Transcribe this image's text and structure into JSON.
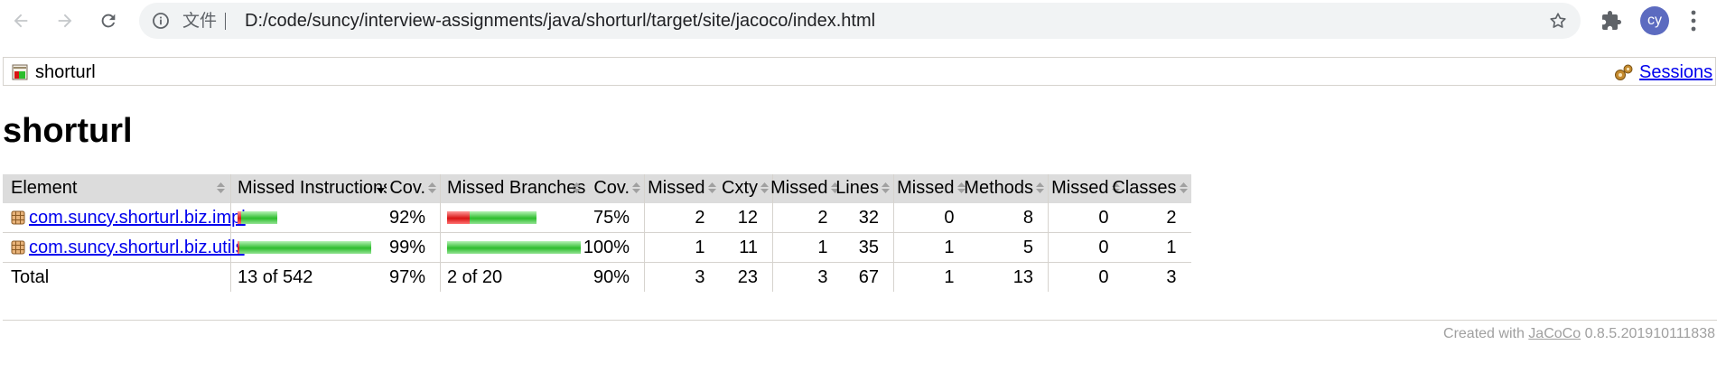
{
  "browser": {
    "back_icon": "back-arrow-icon",
    "forward_icon": "forward-arrow-icon",
    "reload_icon": "reload-icon",
    "site_info_label": "文件",
    "url": "D:/code/suncy/interview-assignments/java/shorturl/target/site/jacoco/index.html",
    "avatar_initials": "cy"
  },
  "breadcrumb": {
    "label": "shorturl",
    "sessions_label": "Sessions"
  },
  "page_title": "shorturl",
  "table": {
    "headers": {
      "element": "Element",
      "missed_instructions": "Missed Instructions",
      "instr_cov": "Cov.",
      "missed_branches": "Missed Branches",
      "branch_cov": "Cov.",
      "missed_cxty": "Missed",
      "cxty": "Cxty",
      "missed_lines": "Missed",
      "lines": "Lines",
      "missed_methods": "Missed",
      "methods": "Methods",
      "missed_classes": "Missed",
      "classes": "Classes"
    },
    "rows": [
      {
        "element": "com.suncy.shorturl.biz.impl",
        "instr_bar": {
          "missed_fraction": 0.08,
          "width_fraction": 0.3
        },
        "instr_cov": "92%",
        "branch_bar": {
          "missed_fraction": 0.25,
          "width_fraction": 0.667
        },
        "branch_cov": "75%",
        "missed_cxty": "2",
        "cxty": "12",
        "missed_lines": "2",
        "lines": "32",
        "missed_methods": "0",
        "methods": "8",
        "missed_classes": "0",
        "classes": "2"
      },
      {
        "element": "com.suncy.shorturl.biz.utils",
        "instr_bar": {
          "missed_fraction": 0.01,
          "width_fraction": 1.0
        },
        "instr_cov": "99%",
        "branch_bar": {
          "missed_fraction": 0.0,
          "width_fraction": 1.0
        },
        "branch_cov": "100%",
        "missed_cxty": "1",
        "cxty": "11",
        "missed_lines": "1",
        "lines": "35",
        "missed_methods": "1",
        "methods": "5",
        "missed_classes": "0",
        "classes": "1"
      }
    ],
    "total": {
      "label": "Total",
      "missed_instructions": "13 of 542",
      "instr_cov": "97%",
      "missed_branches": "2 of 20",
      "branch_cov": "90%",
      "missed_cxty": "3",
      "cxty": "23",
      "missed_lines": "3",
      "lines": "67",
      "missed_methods": "1",
      "methods": "13",
      "missed_classes": "0",
      "classes": "3"
    }
  },
  "footer": {
    "prefix": "Created with",
    "link": "JaCoCo",
    "version": "0.8.5.201910111838"
  },
  "colors": {
    "bar_missed": "#d81313",
    "bar_covered": "#2dbd2d",
    "header_bg": "#dcdcdc",
    "link": "#0000ee",
    "avatar_bg": "#5c6bc0"
  }
}
